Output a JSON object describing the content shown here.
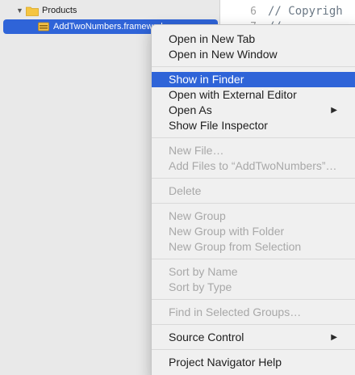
{
  "navigator": {
    "group_label": "Products",
    "selected_file": "AddTwoNumbers.framework"
  },
  "editor": {
    "lines": [
      {
        "number": "6",
        "text": "//  Copyrigh"
      },
      {
        "number": "7",
        "text": "//"
      }
    ]
  },
  "context_menu": {
    "items": [
      {
        "label": "Open in New Tab",
        "enabled": true
      },
      {
        "label": "Open in New Window",
        "enabled": true
      },
      {
        "label": "Show in Finder",
        "enabled": true,
        "highlighted": true
      },
      {
        "label": "Open with External Editor",
        "enabled": true
      },
      {
        "label": "Open As",
        "enabled": true,
        "submenu": true
      },
      {
        "label": "Show File Inspector",
        "enabled": true
      },
      {
        "label": "New File…",
        "enabled": false
      },
      {
        "label": "Add Files to “AddTwoNumbers”…",
        "enabled": false
      },
      {
        "label": "Delete",
        "enabled": false
      },
      {
        "label": "New Group",
        "enabled": false
      },
      {
        "label": "New Group with Folder",
        "enabled": false
      },
      {
        "label": "New Group from Selection",
        "enabled": false
      },
      {
        "label": "Sort by Name",
        "enabled": false
      },
      {
        "label": "Sort by Type",
        "enabled": false
      },
      {
        "label": "Find in Selected Groups…",
        "enabled": false
      },
      {
        "label": "Source Control",
        "enabled": true,
        "submenu": true
      },
      {
        "label": "Project Navigator Help",
        "enabled": true
      }
    ],
    "submenu_arrow": "▶"
  },
  "colors": {
    "selection": "#2f64d8",
    "folder": "#f5c542"
  }
}
